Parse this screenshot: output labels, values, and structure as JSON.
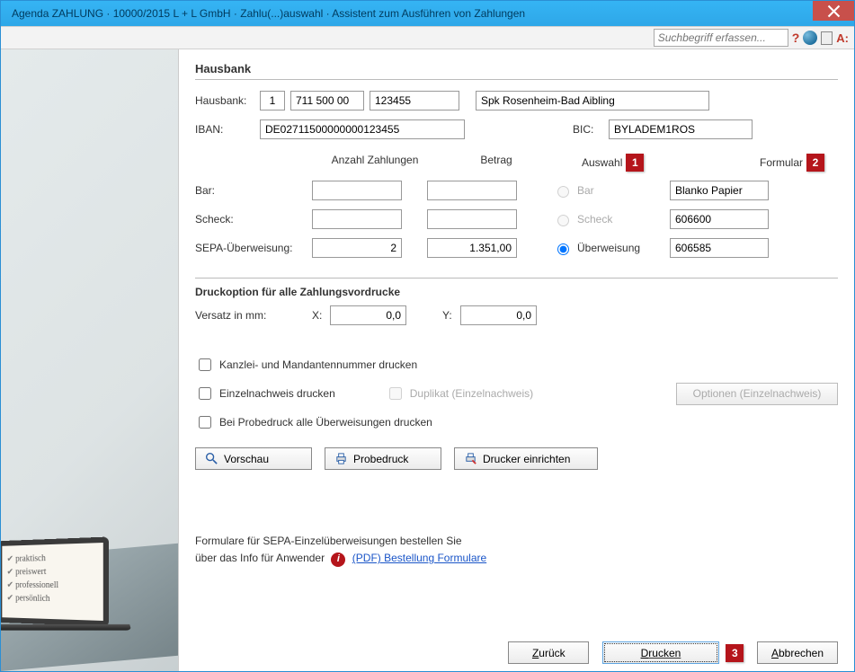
{
  "window": {
    "title": "Agenda ZAHLUNG · 10000/2015 L + L GmbH · Zahlu(...)auswahl · Assistent zum Ausführen von Zahlungen"
  },
  "toolbar": {
    "search_placeholder": "Suchbegriff erfassen..."
  },
  "sidebar_tags": [
    "praktisch",
    "preiswert",
    "professionell",
    "persönlich"
  ],
  "hausbank": {
    "title": "Hausbank",
    "label": "Hausbank:",
    "num": "1",
    "blz": "711 500 00",
    "konto": "123455",
    "name": "Spk Rosenheim-Bad Aibling",
    "iban_label": "IBAN:",
    "iban": "DE02711500000000123455",
    "bic_label": "BIC:",
    "bic": "BYLADEM1ROS"
  },
  "columns": {
    "anzahl": "Anzahl Zahlungen",
    "betrag": "Betrag",
    "auswahl": "Auswahl",
    "formular": "Formular",
    "badge1": "1",
    "badge2": "2"
  },
  "rows": {
    "bar": {
      "label": "Bar:",
      "anzahl": "",
      "betrag": "",
      "radio": "Bar",
      "formular": "Blanko Papier"
    },
    "scheck": {
      "label": "Scheck:",
      "anzahl": "",
      "betrag": "",
      "radio": "Scheck",
      "formular": "606600"
    },
    "sepa": {
      "label": "SEPA-Überweisung:",
      "anzahl": "2",
      "betrag": "1.351,00",
      "radio": "Überweisung",
      "formular": "606585"
    }
  },
  "druck": {
    "title": "Druckoption für alle Zahlungsvordrucke",
    "versatz_label": "Versatz in mm:",
    "x_label": "X:",
    "x_val": "0,0",
    "y_label": "Y:",
    "y_val": "0,0",
    "chk1": "Kanzlei- und Mandantennummer drucken",
    "chk2": "Einzelnachweis drucken",
    "chk2b": "Duplikat (Einzelnachweis)",
    "chk3": "Bei Probedruck alle Überweisungen drucken",
    "btn_optionen": "Optionen (Einzelnachweis)",
    "btn_vorschau": "Vorschau",
    "btn_probedruck": "Probedruck",
    "btn_drucker": "Drucker einrichten"
  },
  "order": {
    "line1": "Formulare für SEPA-Einzelüberweisungen bestellen Sie",
    "line2a": "über das Info für Anwender",
    "link": "(PDF) Bestellung Formulare"
  },
  "footer": {
    "back": "Zurück",
    "back_u": "Z",
    "print": "Drucken",
    "print_u": "D",
    "badge3": "3",
    "cancel": "Abbrechen",
    "cancel_u": "A"
  }
}
